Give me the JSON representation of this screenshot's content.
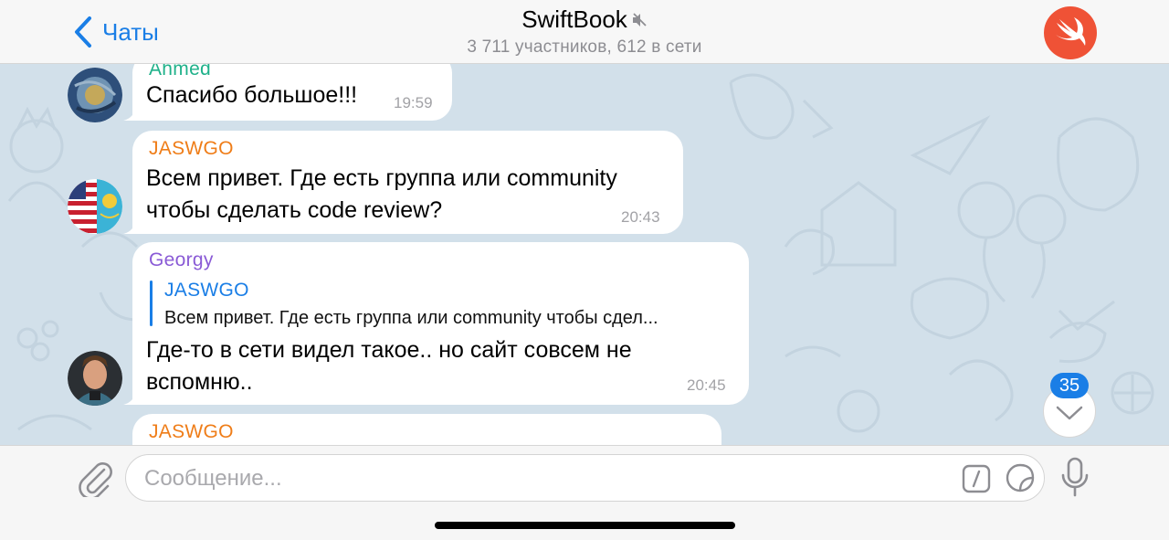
{
  "header": {
    "back_label": "Чаты",
    "title": "SwiftBook",
    "subtitle": "3 711 участников, 612 в сети"
  },
  "messages": [
    {
      "sender": "Ahmed",
      "sender_color": "#1fb18a",
      "text": "Спасибо большое!!!",
      "time": "19:59"
    },
    {
      "sender": "JASWGO",
      "sender_color": "#ef7d18",
      "text_lines": [
        "Всем привет. Где есть группа или community",
        "чтобы сделать code review?"
      ],
      "time": "20:43"
    },
    {
      "sender": "Georgy",
      "sender_color": "#8a5bd6",
      "reply": {
        "name": "JASWGO",
        "text": "Всем привет. Где есть группа или community чтобы сдел..."
      },
      "text_lines": [
        "Где-то в сети видел такое.. но сайт совсем не",
        "вспомню.."
      ],
      "time": "20:45"
    },
    {
      "sender": "JASWGO",
      "sender_color": "#ef7d18"
    }
  ],
  "unread_count": "35",
  "composer": {
    "placeholder": "Сообщение..."
  },
  "colors": {
    "accent": "#1a7ee6",
    "chat_bg": "#d2e0ea",
    "channel_avatar": "#ef5236"
  },
  "icons": [
    "back-chevron-icon",
    "mute-icon",
    "swift-logo-icon",
    "chevron-down-icon",
    "paperclip-icon",
    "command-icon",
    "sticker-icon",
    "microphone-icon"
  ]
}
